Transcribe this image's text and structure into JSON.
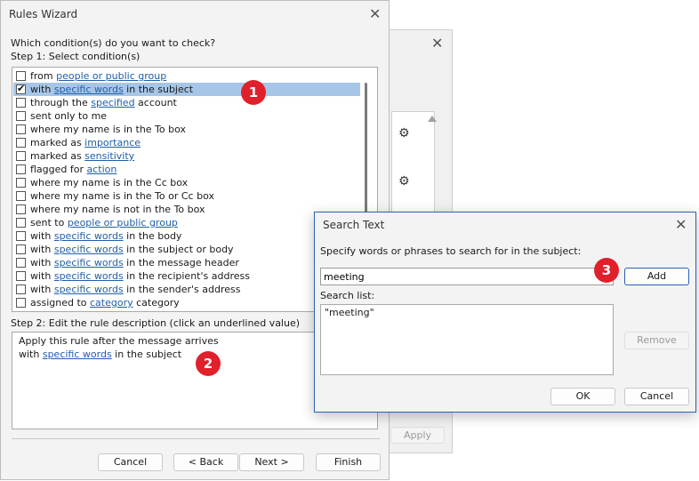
{
  "rules_wizard": {
    "title": "Rules Wizard",
    "question": "Which condition(s) do you want to check?",
    "step1_label": "Step 1: Select condition(s)",
    "conditions": [
      {
        "parts": [
          "from ",
          "people or public group",
          ""
        ],
        "checked": false
      },
      {
        "parts": [
          "with ",
          "specific words",
          " in the subject"
        ],
        "checked": true
      },
      {
        "parts": [
          "through the ",
          "specified",
          " account"
        ],
        "checked": false
      },
      {
        "parts": [
          "sent only to me",
          "",
          ""
        ],
        "checked": false
      },
      {
        "parts": [
          "where my name is in the To box",
          "",
          ""
        ],
        "checked": false
      },
      {
        "parts": [
          "marked as ",
          "importance",
          ""
        ],
        "checked": false
      },
      {
        "parts": [
          "marked as ",
          "sensitivity",
          ""
        ],
        "checked": false
      },
      {
        "parts": [
          "flagged for ",
          "action",
          ""
        ],
        "checked": false
      },
      {
        "parts": [
          "where my name is in the Cc box",
          "",
          ""
        ],
        "checked": false
      },
      {
        "parts": [
          "where my name is in the To or Cc box",
          "",
          ""
        ],
        "checked": false
      },
      {
        "parts": [
          "where my name is not in the To box",
          "",
          ""
        ],
        "checked": false
      },
      {
        "parts": [
          "sent to ",
          "people or public group",
          ""
        ],
        "checked": false
      },
      {
        "parts": [
          "with ",
          "specific words",
          " in the body"
        ],
        "checked": false
      },
      {
        "parts": [
          "with ",
          "specific words",
          " in the subject or body"
        ],
        "checked": false
      },
      {
        "parts": [
          "with ",
          "specific words",
          " in the message header"
        ],
        "checked": false
      },
      {
        "parts": [
          "with ",
          "specific words",
          " in the recipient's address"
        ],
        "checked": false
      },
      {
        "parts": [
          "with ",
          "specific words",
          " in the sender's address"
        ],
        "checked": false
      },
      {
        "parts": [
          "assigned to ",
          "category",
          " category"
        ],
        "checked": false
      }
    ],
    "step2_label": "Step 2: Edit the rule description (click an underlined value)",
    "desc_line1": "Apply this rule after the message arrives",
    "desc_line2_pre": "with ",
    "desc_line2_link": "specific words",
    "desc_line2_post": " in the subject",
    "buttons": {
      "cancel": "Cancel",
      "back": "< Back",
      "next": "Next >",
      "finish": "Finish"
    }
  },
  "background_dialog": {
    "apply": "Apply"
  },
  "search_text": {
    "title": "Search Text",
    "prompt": "Specify words or phrases to search for in the subject:",
    "input_value": "meeting",
    "search_list_label": "Search list:",
    "list_items": [
      "\"meeting\""
    ],
    "buttons": {
      "add": "Add",
      "remove": "Remove",
      "ok": "OK",
      "cancel": "Cancel"
    }
  },
  "badges": [
    "1",
    "2",
    "3"
  ]
}
